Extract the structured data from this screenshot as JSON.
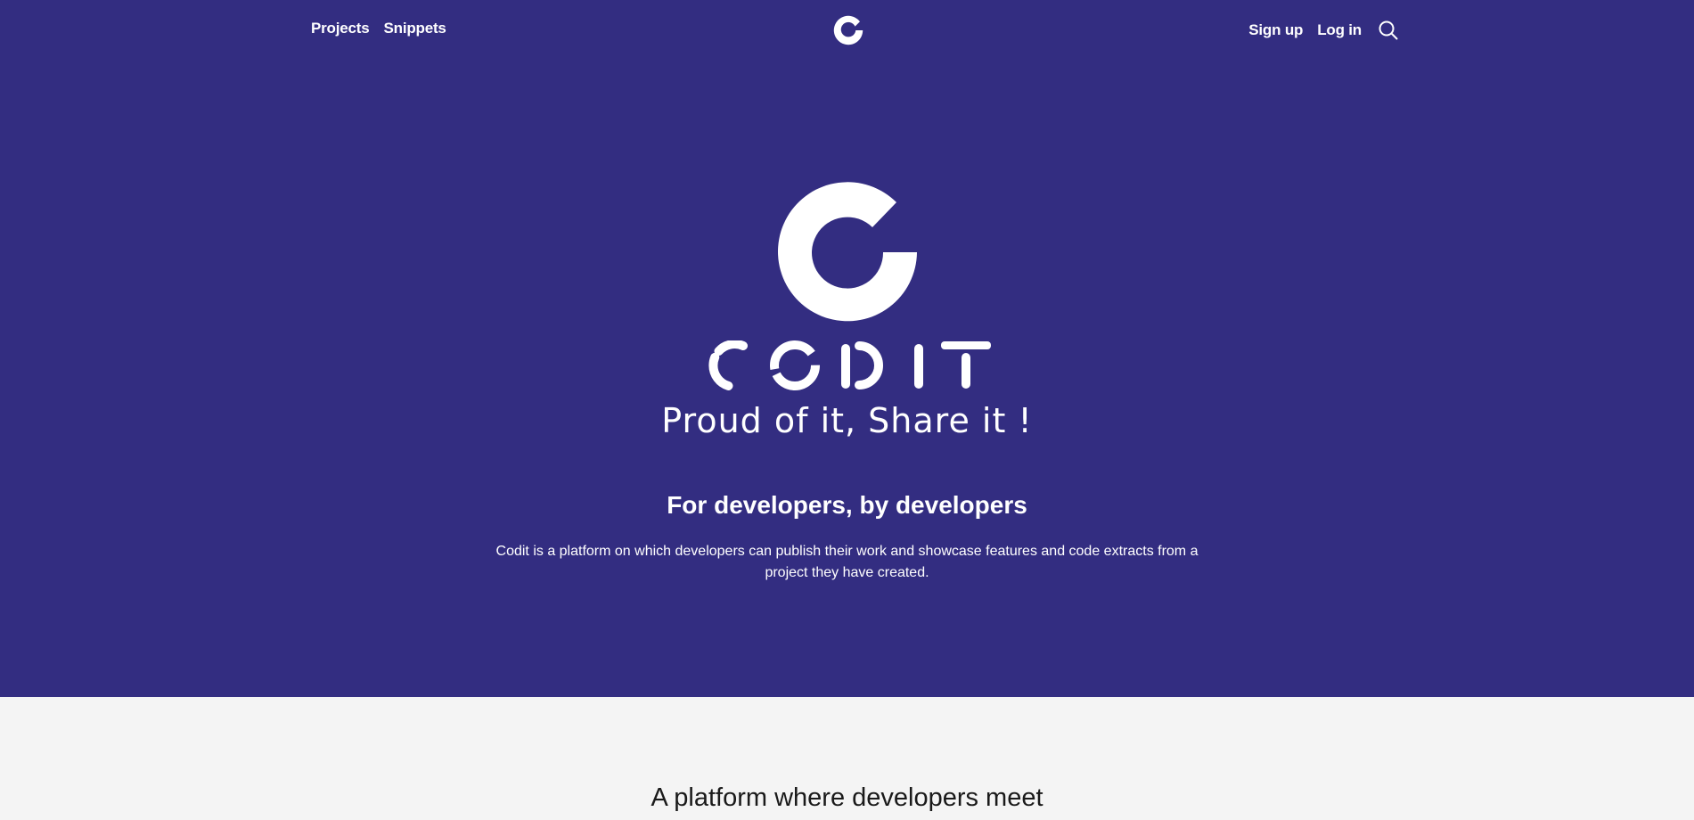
{
  "nav": {
    "projects_label": "Projects",
    "snippets_label": "Snippets",
    "signup_label": "Sign up",
    "login_label": "Log in",
    "logo_icon": "codit-c-logo-icon",
    "search_icon": "search-icon"
  },
  "hero": {
    "logo_icon": "codit-c-logo-icon",
    "wordmark": "CODIT",
    "tagline": "Proud of it, Share it !",
    "headline": "For developers, by developers",
    "description": "Codit is a platform on which developers can publish their work and showcase features and code extracts from a project they have created."
  },
  "section": {
    "title": "A platform where developers meet"
  },
  "colors": {
    "hero_background": "#332d81",
    "text_on_hero": "#ffffff",
    "section_background": "#f4f4f4",
    "section_text": "#1a1a1a"
  }
}
